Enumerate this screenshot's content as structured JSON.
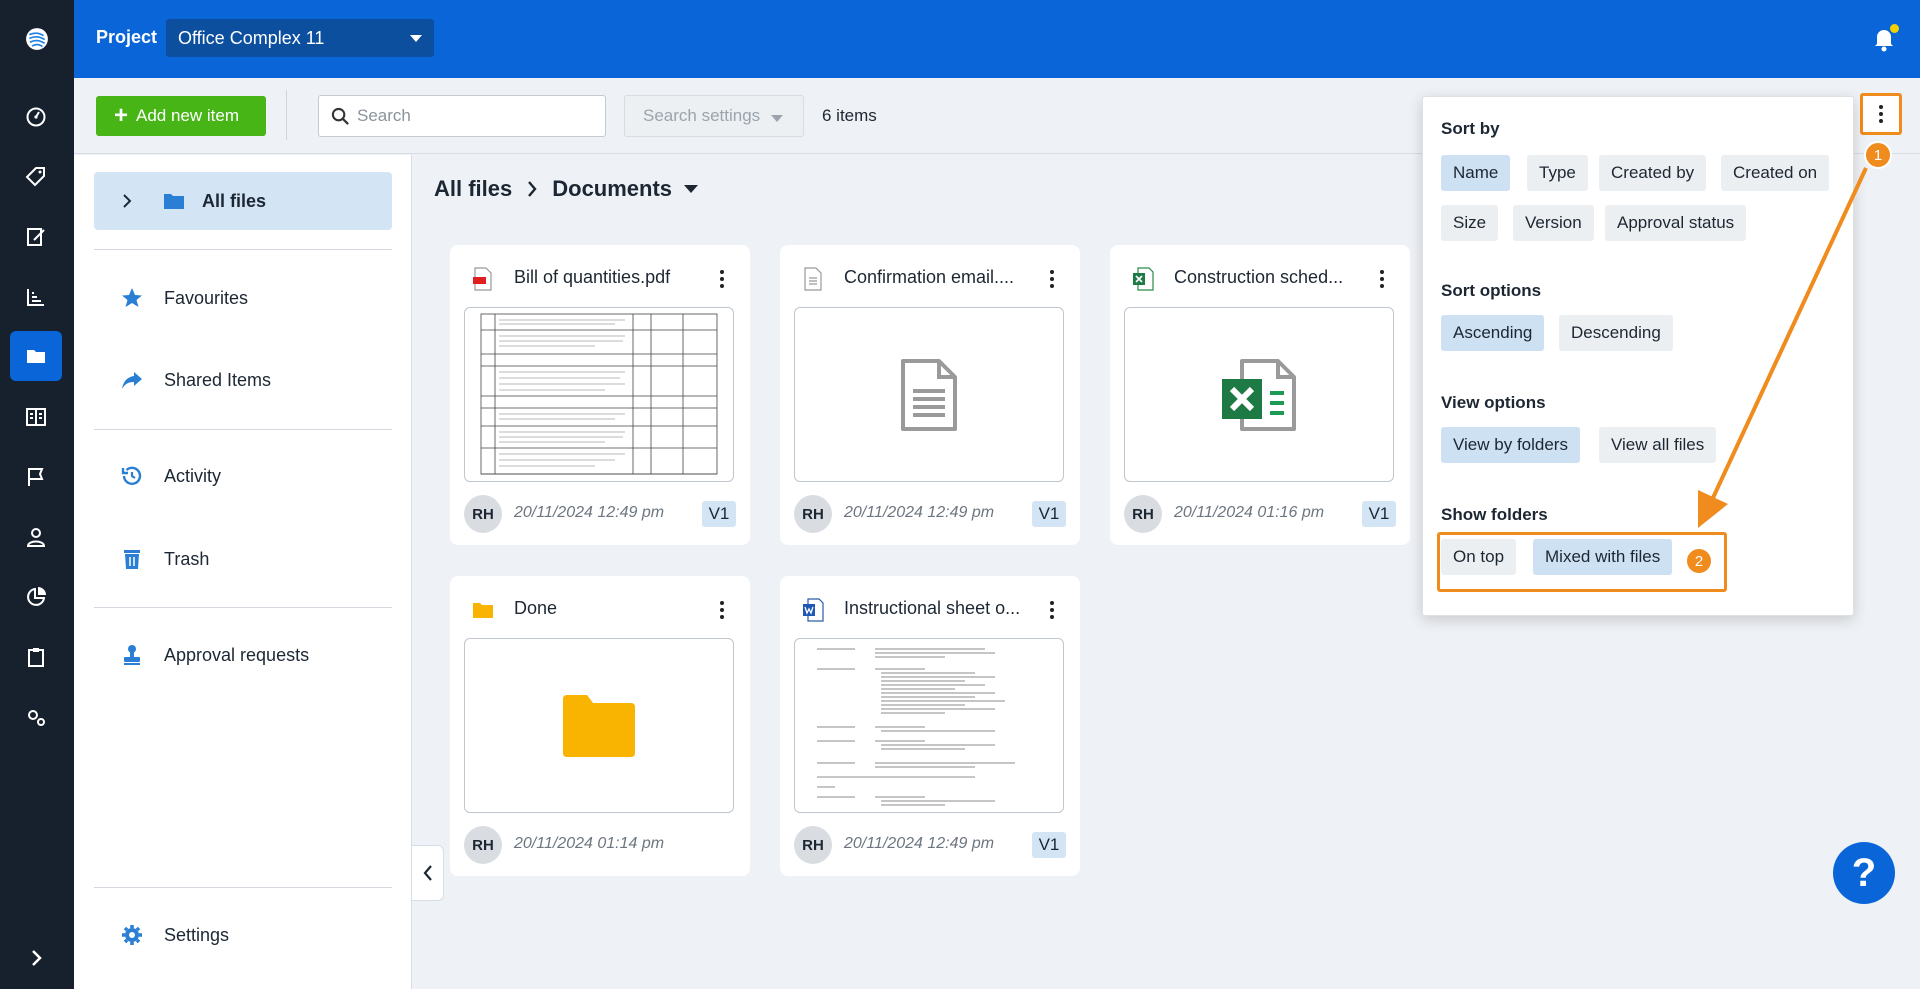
{
  "topbar": {
    "project_label": "Project",
    "project_name": "Office Complex 11"
  },
  "toolbar": {
    "add_label": "Add new item",
    "search_placeholder": "Search",
    "search_value": "",
    "search_settings_label": "Search settings",
    "items_count": "6 items"
  },
  "sidebar": {
    "items": [
      {
        "label": "All files",
        "icon": "folder-icon"
      },
      {
        "label": "Favourites",
        "icon": "star-icon"
      },
      {
        "label": "Shared Items",
        "icon": "share-icon"
      },
      {
        "label": "Activity",
        "icon": "history-icon"
      },
      {
        "label": "Trash",
        "icon": "trash-icon"
      },
      {
        "label": "Approval requests",
        "icon": "stamp-icon"
      },
      {
        "label": "Settings",
        "icon": "gear-icon"
      }
    ]
  },
  "breadcrumb": {
    "root": "All files",
    "current": "Documents"
  },
  "files": [
    {
      "name": "Bill of quantities.pdf",
      "type": "pdf",
      "user": "RH",
      "date": "20/11/2024 12:49 pm",
      "version": "V1"
    },
    {
      "name": "Confirmation email....",
      "type": "doc",
      "user": "RH",
      "date": "20/11/2024 12:49 pm",
      "version": "V1"
    },
    {
      "name": "Construction sched...",
      "type": "xls",
      "user": "RH",
      "date": "20/11/2024 01:16 pm",
      "version": "V1"
    },
    {
      "name": "Done",
      "type": "folder",
      "user": "RH",
      "date": "20/11/2024 01:14 pm",
      "version": ""
    },
    {
      "name": "Instructional sheet o...",
      "type": "word",
      "user": "RH",
      "date": "20/11/2024 12:49 pm",
      "version": "V1"
    }
  ],
  "panel": {
    "sort_by_title": "Sort by",
    "sort_by": [
      "Name",
      "Type",
      "Created by",
      "Created on",
      "Size",
      "Version",
      "Approval status"
    ],
    "sort_by_selected": "Name",
    "sort_options_title": "Sort options",
    "sort_options": [
      "Ascending",
      "Descending"
    ],
    "sort_options_selected": "Ascending",
    "view_options_title": "View options",
    "view_options": [
      "View by folders",
      "View all files"
    ],
    "view_options_selected": "View by folders",
    "show_folders_title": "Show folders",
    "show_folders": [
      "On top",
      "Mixed with files"
    ],
    "show_folders_selected": "Mixed with files"
  },
  "annotations": {
    "step1": "1",
    "step2": "2",
    "color": "#f08b1d"
  },
  "help_label": "?",
  "colors": {
    "primary": "#0a66d8",
    "rail": "#17212e",
    "add_button": "#46b515",
    "selected_chip": "#cde1f2"
  }
}
